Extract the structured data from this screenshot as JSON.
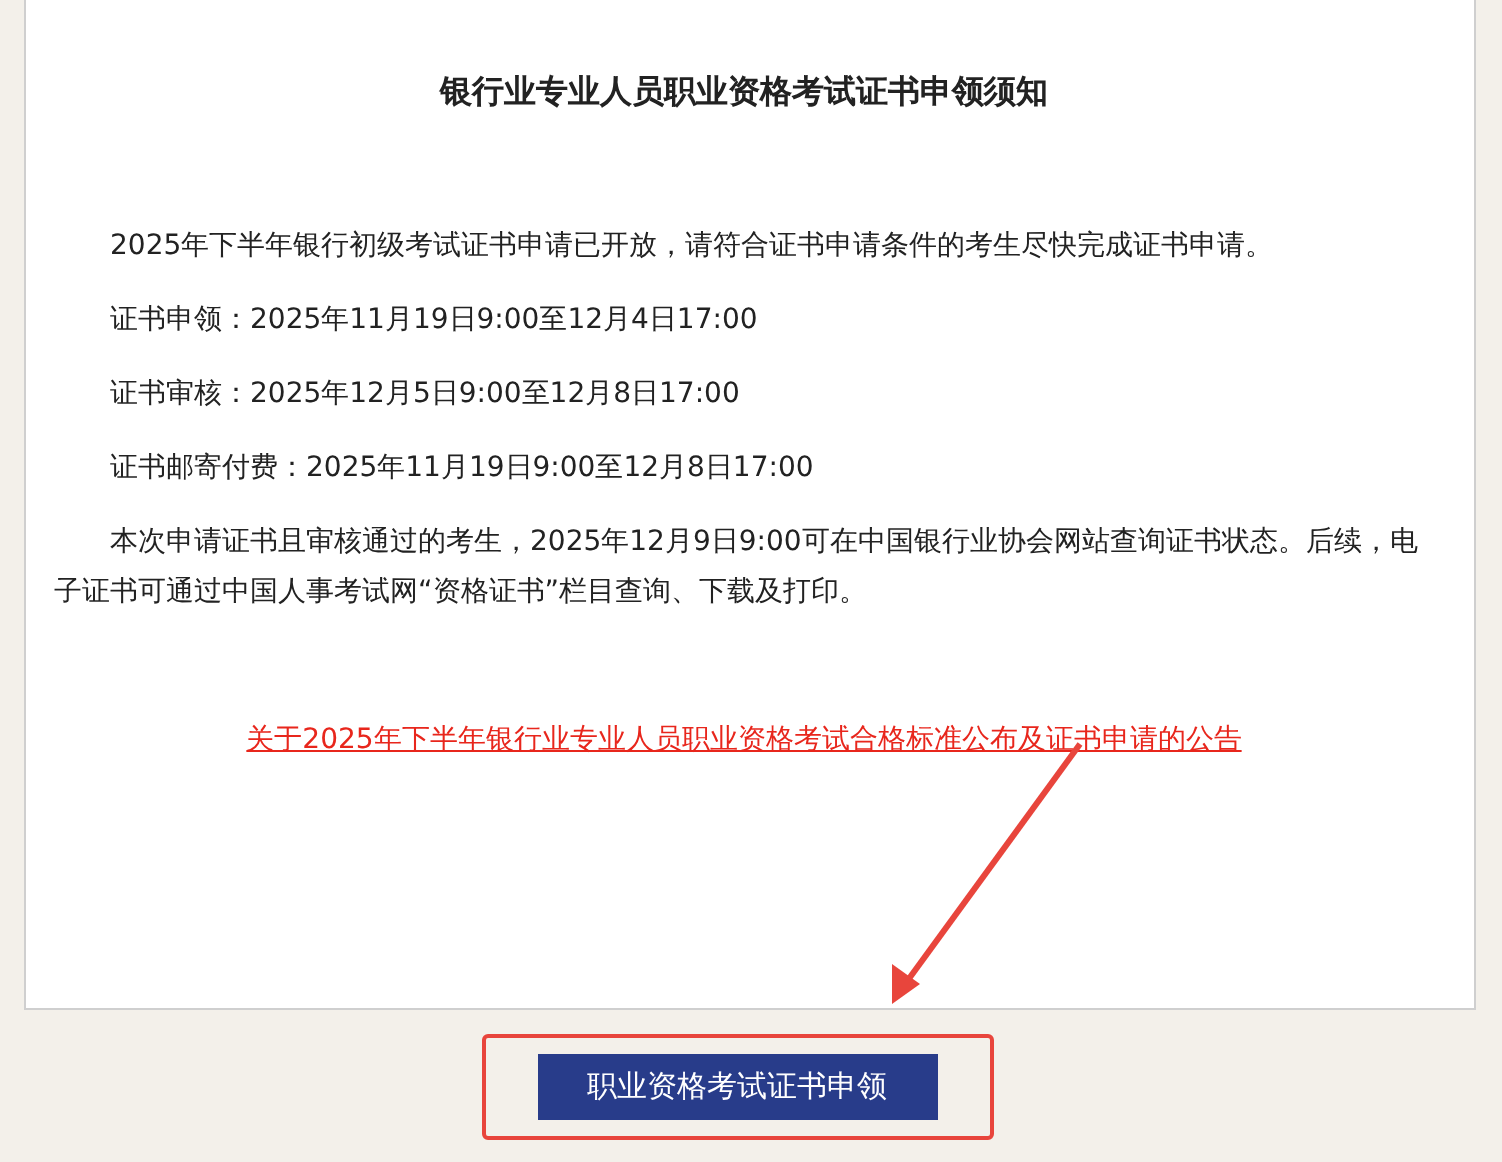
{
  "notice": {
    "title": "银行业专业人员职业资格考试证书申领须知",
    "paragraphs": [
      "2025年下半年银行初级考试证书申请已开放，请符合证书申请条件的考生尽快完成证书申请。",
      "证书申领：2025年11月19日9:00至12月4日17:00",
      "证书审核：2025年12月5日9:00至12月8日17:00",
      "证书邮寄付费：2025年11月19日9:00至12月8日17:00",
      "本次申请证书且审核通过的考生，2025年12月9日9:00可在中国银行业协会网站查询证书状态。后续，电子证书可通过中国人事考试网“资格证书”栏目查询、下载及打印。"
    ],
    "link": "关于2025年下半年银行业专业人员职业资格考试合格标准公布及证书申请的公告"
  },
  "button": "职业资格考试证书申领",
  "annotation": {
    "arrow": true,
    "highlight_box": true
  }
}
